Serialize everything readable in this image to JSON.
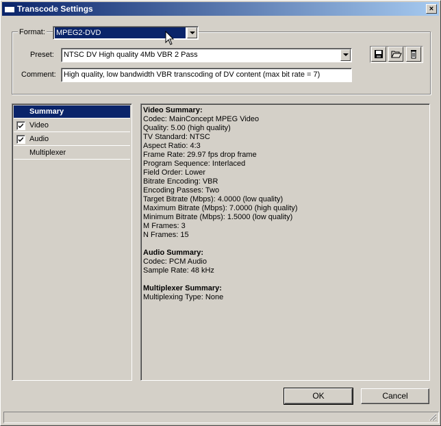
{
  "window": {
    "title": "Transcode Settings",
    "close_label": "×"
  },
  "format": {
    "label": "Format:",
    "value": "MPEG2-DVD"
  },
  "preset": {
    "label": "Preset:",
    "value": "NTSC DV High quality 4Mb VBR 2 Pass"
  },
  "comment": {
    "label": "Comment:",
    "value": "High quality, low bandwidth VBR transcoding of DV content (max bit rate = 7)"
  },
  "toolbar": {
    "icons": [
      "save-icon",
      "open-folder-icon",
      "delete-icon"
    ]
  },
  "nav": {
    "items": [
      {
        "label": "Summary",
        "selected": true,
        "checkbox": false
      },
      {
        "label": "Video",
        "selected": false,
        "checkbox": true,
        "checked": true
      },
      {
        "label": "Audio",
        "selected": false,
        "checkbox": true,
        "checked": true
      },
      {
        "label": "Multiplexer",
        "selected": false,
        "checkbox": false
      }
    ]
  },
  "summary": {
    "video_heading": "Video Summary:",
    "video_lines": [
      "Codec: MainConcept MPEG Video",
      "Quality: 5.00 (high quality)",
      "TV Standard: NTSC",
      "Aspect Ratio: 4:3",
      "Frame Rate: 29.97 fps drop frame",
      "Program Sequence: Interlaced",
      "Field Order: Lower",
      "Bitrate Encoding: VBR",
      "Encoding Passes: Two",
      "Target Bitrate (Mbps): 4.0000 (low quality)",
      "Maximum Bitrate (Mbps): 7.0000 (high quality)",
      "Minimum Bitrate (Mbps): 1.5000 (low quality)",
      "M Frames: 3",
      "N Frames: 15"
    ],
    "audio_heading": "Audio Summary:",
    "audio_lines": [
      "Codec: PCM Audio",
      "Sample Rate: 48 kHz"
    ],
    "mux_heading": "Multiplexer Summary:",
    "mux_lines": [
      "Multiplexing Type: None"
    ]
  },
  "buttons": {
    "ok_label": "OK",
    "cancel_label": "Cancel"
  },
  "colors": {
    "selection": "#0a246a",
    "face": "#d4d0c8"
  }
}
